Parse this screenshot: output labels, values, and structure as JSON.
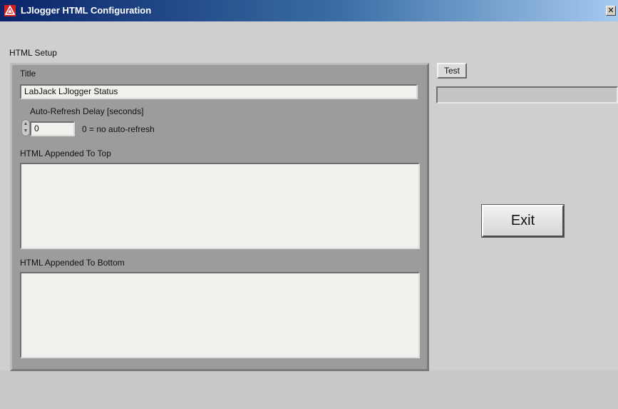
{
  "window": {
    "title": "LJlogger HTML Configuration",
    "close_glyph": "✕",
    "icon": "labjack-logo-icon"
  },
  "setup": {
    "section_label": "HTML Setup",
    "title_label": "Title",
    "title_value": "LabJack LJlogger Status",
    "refresh_label": "Auto-Refresh Delay [seconds]",
    "refresh_value": "0",
    "refresh_hint": "0 = no auto-refresh",
    "top_label": "HTML Appended To Top",
    "top_value": "",
    "bottom_label": "HTML Appended To Bottom",
    "bottom_value": ""
  },
  "controls": {
    "test_label": "Test",
    "status_value": "",
    "exit_label": "Exit"
  },
  "colors": {
    "titlebar_start": "#0a246a",
    "titlebar_end": "#a6caf0",
    "panel": "#9c9c9c",
    "field": "#eef1ec",
    "background": "#cfcfcf"
  }
}
